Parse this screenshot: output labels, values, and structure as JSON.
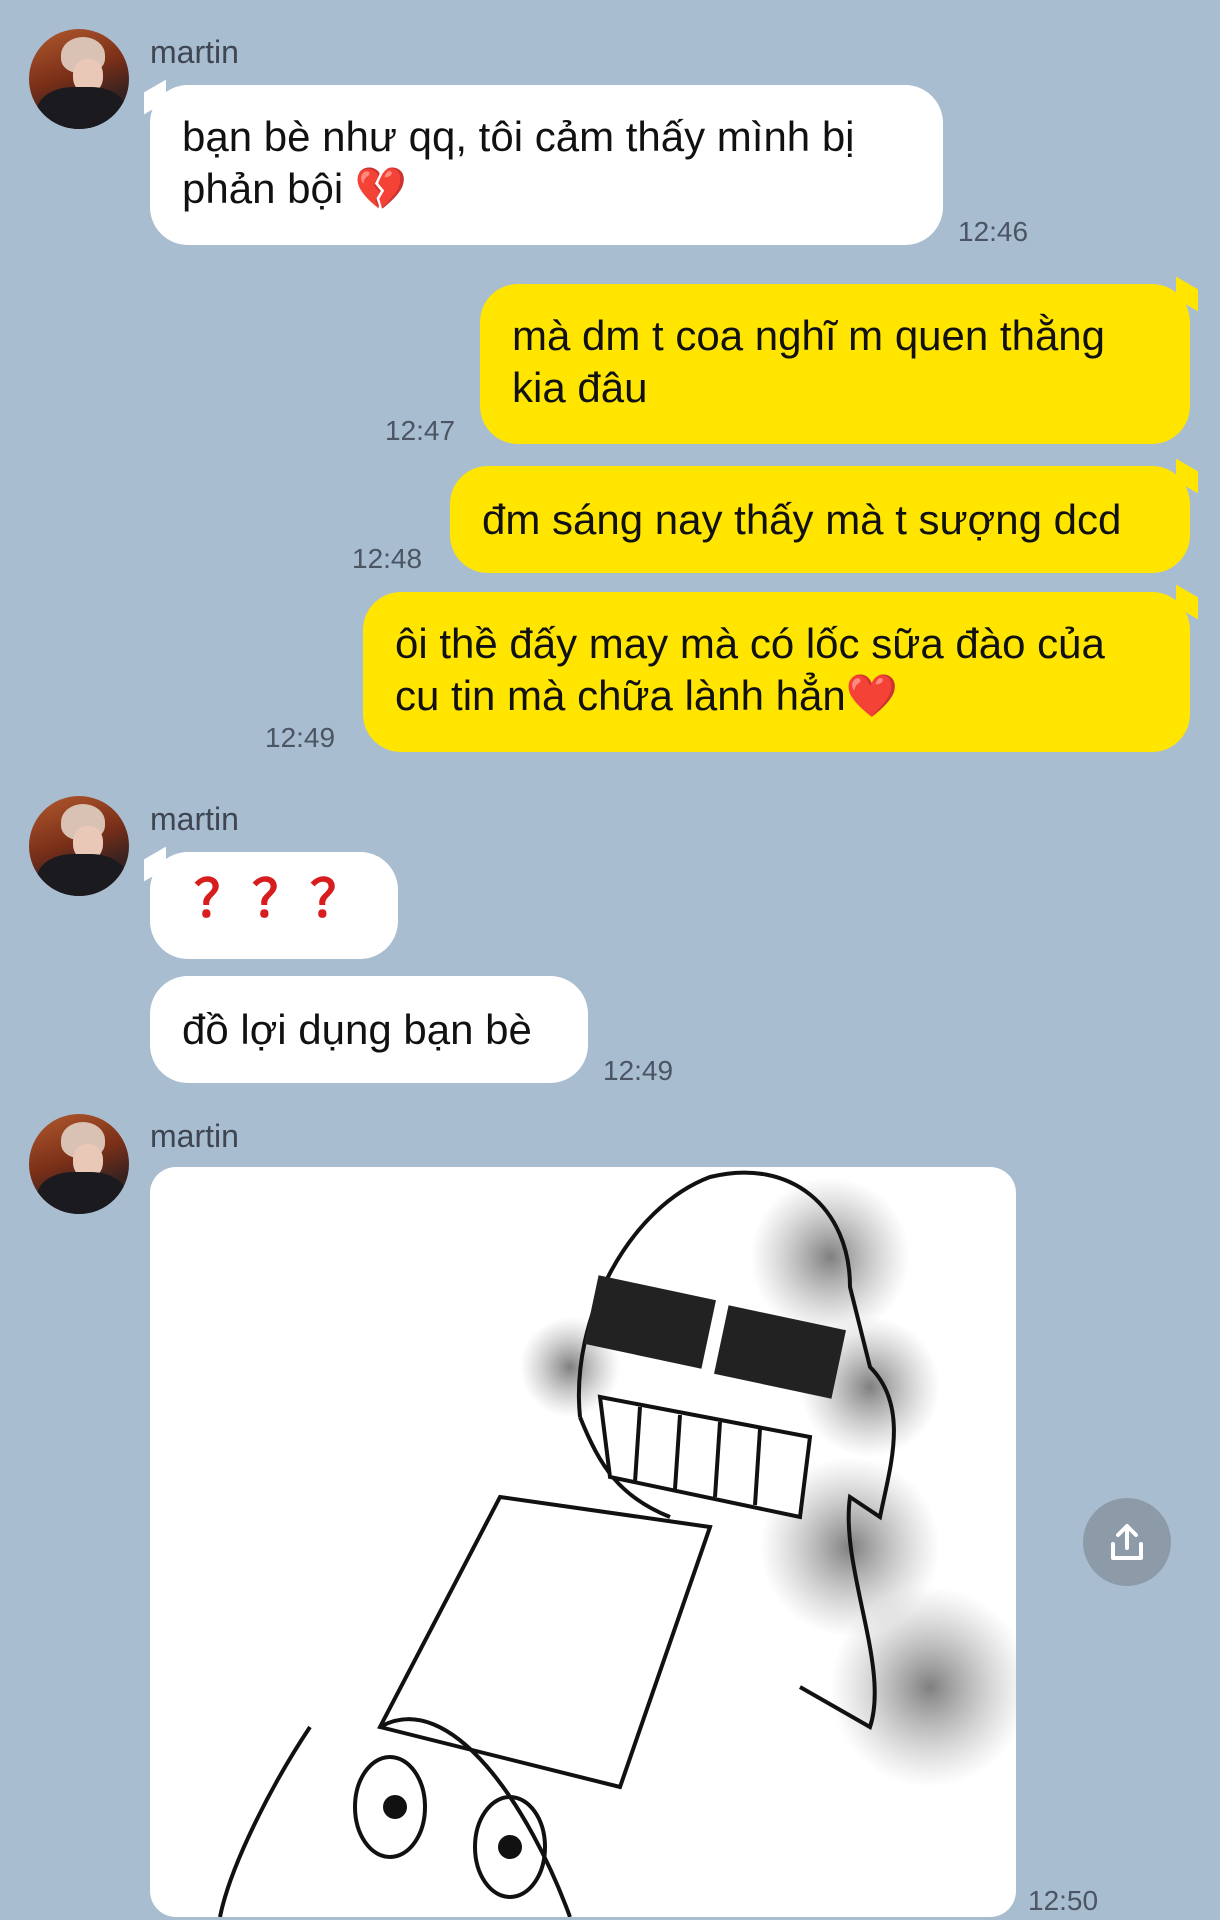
{
  "sender": {
    "name": "martin"
  },
  "messages": [
    {
      "direction": "incoming",
      "text": "bạn bè như qq, tôi cảm thấy mình bị phản bội 💔",
      "time": "12:46"
    },
    {
      "direction": "outgoing",
      "text": "mà dm t coa nghĩ m quen thằng kia đâu",
      "time": "12:47"
    },
    {
      "direction": "outgoing",
      "text": "đm sáng nay thấy mà t sượng dcd",
      "time": "12:48"
    },
    {
      "direction": "outgoing",
      "text": "ôi thề đấy may mà có lốc sữa đào của cu tin mà chữa lành hẳn❤️",
      "time": "12:49"
    },
    {
      "direction": "incoming",
      "text": "？？？",
      "time": ""
    },
    {
      "direction": "incoming",
      "text": "đồ lợi dụng bạn bè",
      "time": "12:49"
    },
    {
      "direction": "incoming",
      "type": "sticker",
      "time": "12:50"
    }
  ],
  "icons": {
    "share": "share-icon"
  },
  "colors": {
    "background": "#a9bdd1",
    "outgoing_bubble": "#ffe500",
    "incoming_bubble": "#ffffff"
  }
}
